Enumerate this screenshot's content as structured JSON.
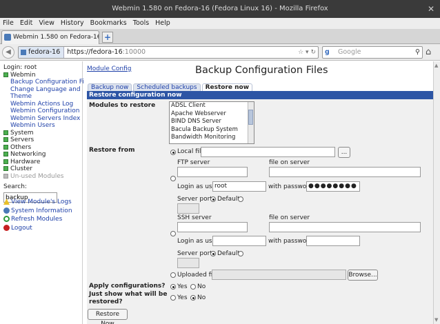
{
  "window": {
    "title": "Webmin 1.580 on Fedora-16 (Fedora Linux 16) - Mozilla Firefox"
  },
  "menu": [
    "File",
    "Edit",
    "View",
    "History",
    "Bookmarks",
    "Tools",
    "Help"
  ],
  "tab": {
    "label": "Webmin 1.580 on Fedora-16 (F..."
  },
  "nav": {
    "site": "fedora-16",
    "url_main": "https://fedora-16",
    "url_port": ":10000",
    "search_placeholder": "Google"
  },
  "sidebar": {
    "login": "Login: root",
    "webmin": "Webmin",
    "webmin_items": [
      "Backup Configuration Files",
      "Change Language and",
      "Theme",
      "Webmin Actions Log",
      "Webmin Configuration",
      "Webmin Servers Index",
      "Webmin Users"
    ],
    "categories": [
      "System",
      "Servers",
      "Others",
      "Networking",
      "Hardware",
      "Cluster",
      "Un-used Modules"
    ],
    "search_label": "Search:",
    "search_value": "backup",
    "links": [
      "View Module's Logs",
      "System Information",
      "Refresh Modules",
      "Logout"
    ]
  },
  "page": {
    "module_config": "Module Config",
    "title": "Backup Configuration Files",
    "tabs": [
      "Backup now",
      "Scheduled backups",
      "Restore now"
    ],
    "section": "Restore configuration now",
    "modules_label": "Modules to restore",
    "modules": [
      "ADSL Client",
      "Apache Webserver",
      "BIND DNS Server",
      "Bacula Backup System",
      "Bandwidth Monitoring"
    ],
    "restore_from": "Restore from",
    "local_file": "Local file",
    "browse_small": "...",
    "ftp_server": "FTP server",
    "file_on_server": "file on server",
    "login_as_user": "Login as user",
    "ftp_user": "root",
    "with_password": "with password",
    "ftp_password": "●●●●●●●●",
    "server_port": "Server port",
    "default": "Default",
    "ssh_server": "SSH server",
    "uploaded_file": "Uploaded file",
    "browse": "Browse...",
    "apply_label": "Apply configurations?",
    "show_label_1": "Just show what will be",
    "show_label_2": "restored?",
    "yes": "Yes",
    "no": "No",
    "restore_button": "Restore Now"
  }
}
